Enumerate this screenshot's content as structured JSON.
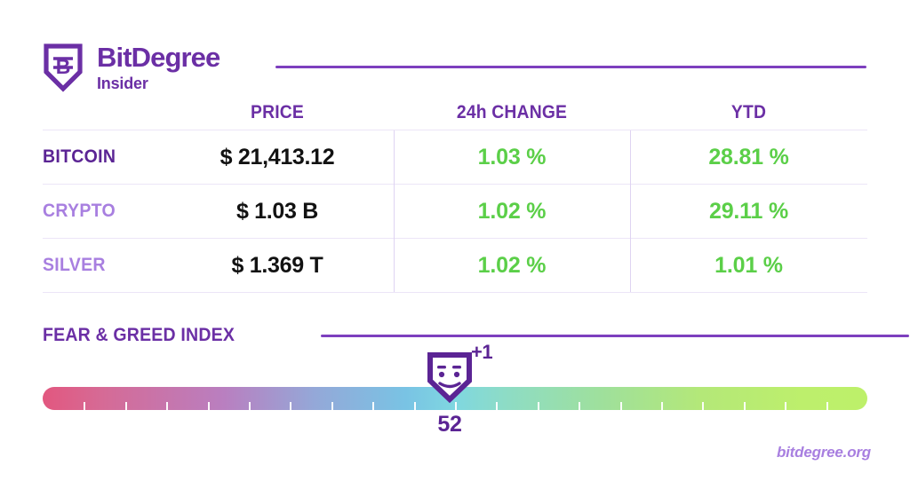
{
  "brand": {
    "title": "BitDegree",
    "subtitle": "Insider",
    "logo_icon": "shield-b-logo-icon",
    "accent_purple": "#6b2fa5",
    "rule_purple": "#7d3fbe"
  },
  "table": {
    "headers": {
      "label": "",
      "price": "PRICE",
      "change": "24h CHANGE",
      "ytd": "YTD"
    },
    "rows": [
      {
        "label": "BITCOIN",
        "price": "$ 21,413.12",
        "change": "1.03 %",
        "ytd": "28.81 %"
      },
      {
        "label": "CRYPTO",
        "price": "$ 1.03 B",
        "change": "1.02 %",
        "ytd": "29.11 %"
      },
      {
        "label": "SILVER",
        "price": "$ 1.369 T",
        "change": "1.02 %",
        "ytd": "1.01 %"
      }
    ],
    "positive_color": "#5bcf48",
    "price_color": "#121212"
  },
  "fear_greed": {
    "title": "FEAR & GREED INDEX",
    "value": "52",
    "delta": "+1",
    "marker_icon": "smiling-shield-face-icon",
    "tick_count": 20,
    "gradient_stops": [
      "#e2577f",
      "#b97fc0",
      "#94a8d8",
      "#79c3e4",
      "#8ddcc6",
      "#9fe09b",
      "#bdf06a"
    ]
  },
  "footer": {
    "url": "bitdegree.org"
  }
}
